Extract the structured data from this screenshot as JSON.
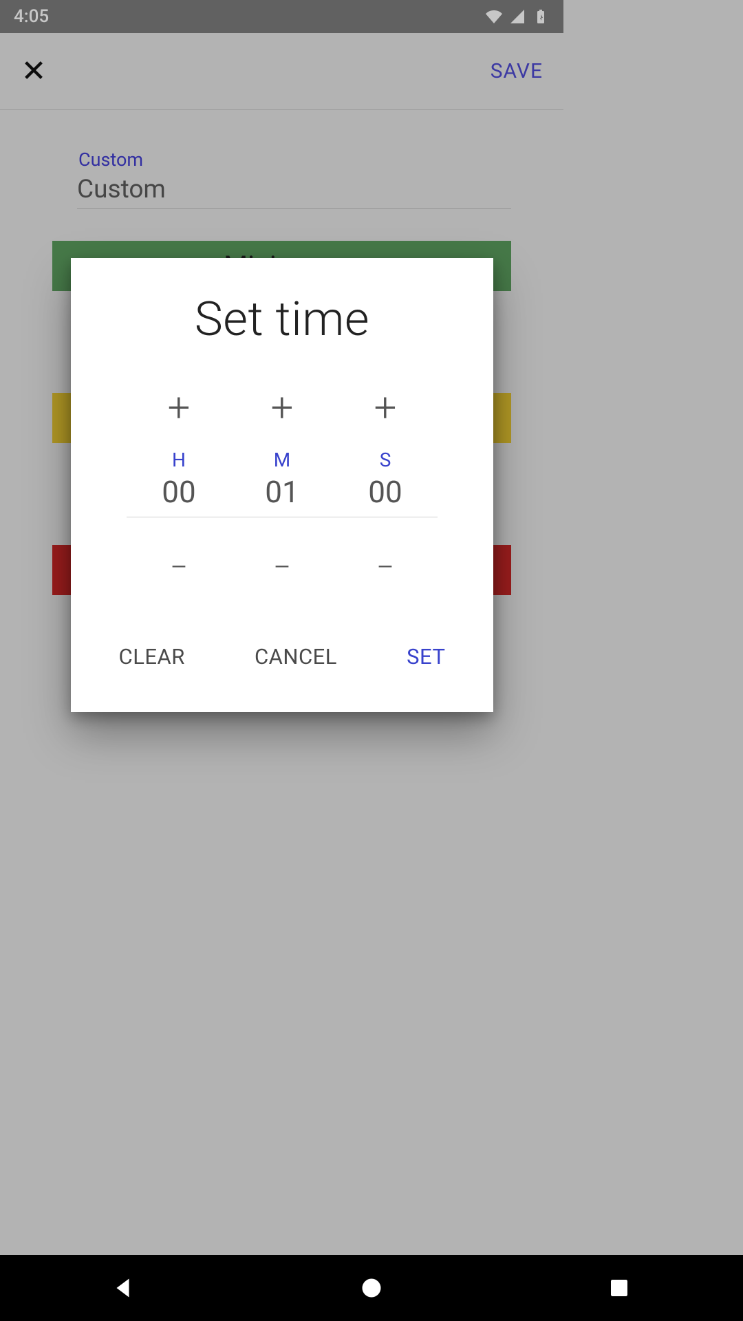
{
  "status": {
    "time": "4:05"
  },
  "topbar": {
    "save": "SAVE"
  },
  "field": {
    "label": "Custom",
    "value": "Custom"
  },
  "bars": {
    "green": "Minimum"
  },
  "dialog": {
    "title": "Set time",
    "hLabel": "H",
    "mLabel": "M",
    "sLabel": "S",
    "hVal": "00",
    "mVal": "01",
    "sVal": "00",
    "plus": "+",
    "minus": "−",
    "clear": "CLEAR",
    "cancel": "CANCEL",
    "set": "SET"
  }
}
